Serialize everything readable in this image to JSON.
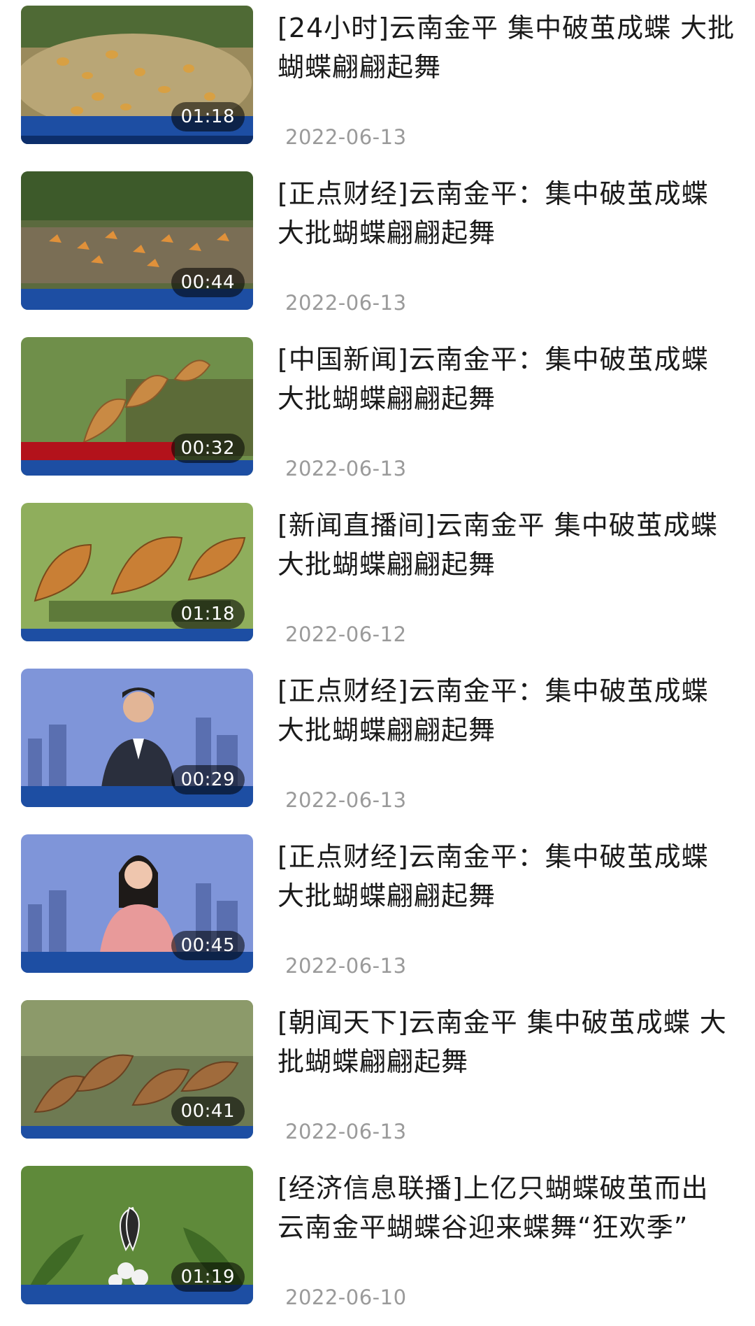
{
  "videos": [
    {
      "title": "[24小时]云南金平 集中破茧成蝶 大批蝴蝶翩翩起舞",
      "duration": "01:18",
      "date": "2022-06-13",
      "thumb_scene": "butterflies-on-ground"
    },
    {
      "title": "[正点财经]云南金平：集中破茧成蝶 大批蝴蝶翩翩起舞",
      "duration": "00:44",
      "date": "2022-06-13",
      "thumb_scene": "butterflies-on-ground"
    },
    {
      "title": "[中国新闻]云南金平：集中破茧成蝶 大批蝴蝶翩翩起舞",
      "duration": "00:32",
      "date": "2022-06-13",
      "thumb_scene": "butterflies-closeup"
    },
    {
      "title": "[新闻直播间]云南金平  集中破茧成蝶 大批蝴蝶翩翩起舞",
      "duration": "01:18",
      "date": "2022-06-12",
      "thumb_scene": "butterflies-closeup"
    },
    {
      "title": "[正点财经]云南金平：集中破茧成蝶 大批蝴蝶翩翩起舞",
      "duration": "00:29",
      "date": "2022-06-13",
      "thumb_scene": "anchor-male"
    },
    {
      "title": "[正点财经]云南金平：集中破茧成蝶 大批蝴蝶翩翩起舞",
      "duration": "00:45",
      "date": "2022-06-13",
      "thumb_scene": "anchor-female"
    },
    {
      "title": "[朝闻天下]云南金平  集中破茧成蝶 大批蝴蝶翩翩起舞",
      "duration": "00:41",
      "date": "2022-06-13",
      "thumb_scene": "butterflies-leaves"
    },
    {
      "title": "[经济信息联播]上亿只蝴蝶破茧而出 云南金平蝴蝶谷迎来蝶舞“狂欢季”",
      "duration": "01:19",
      "date": "2022-06-10",
      "thumb_scene": "butterfly-flower"
    }
  ]
}
